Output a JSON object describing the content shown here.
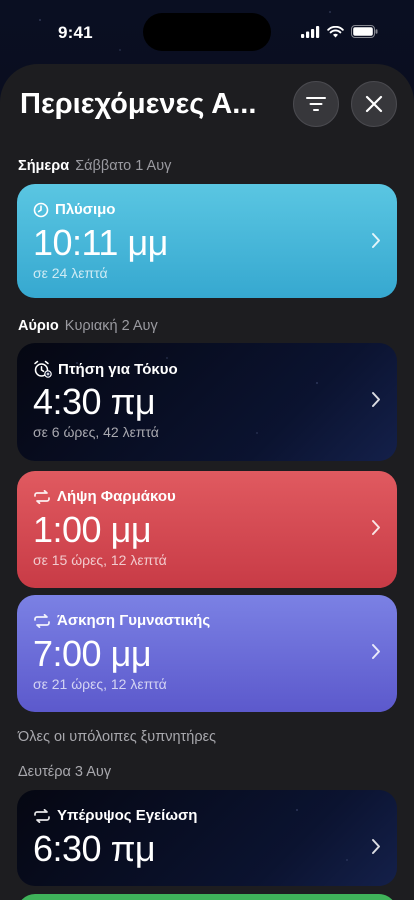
{
  "status_bar": {
    "time": "9:41"
  },
  "sheet": {
    "title": "Περιεχόμενες Α..."
  },
  "sections": {
    "today": {
      "day": "Σήμερα",
      "date": "Σάββατο 1 Αυγ"
    },
    "tomorrow": {
      "day": "Αύριο",
      "date": "Κυριακή 2 Αυγ"
    },
    "others": {
      "label": "Όλες οι υπόλοιπες ξυπνητήρες"
    },
    "monday": {
      "day": "Δευτέρα 3 Αυγ"
    }
  },
  "alarms": [
    {
      "label": "Πλύσιμο",
      "time": "10:11",
      "period": "μμ",
      "sub": "σε 24 λεπτά",
      "icon": "clock-icon",
      "color": "#48b8da"
    },
    {
      "label": "Πτήση για Τόκυο",
      "time": "4:30",
      "period": "πμ",
      "sub": "σε 6 ώρες, 42 λεπτά",
      "icon": "alarm-clock-icon",
      "color": "#0b1330"
    },
    {
      "label": "Λήψη Φαρμάκου",
      "time": "1:00",
      "period": "μμ",
      "sub": "σε 15 ώρες, 12 λεπτά",
      "icon": "repeat-icon",
      "color": "#d44b53"
    },
    {
      "label": "Άσκηση Γυμναστικής",
      "time": "7:00",
      "period": "μμ",
      "sub": "σε 21 ώρες, 12 λεπτά",
      "icon": "repeat-icon",
      "color": "#6b6dd8"
    },
    {
      "label": "Υπέρυψος Εγείωση",
      "time": "6:30",
      "period": "πμ",
      "icon": "repeat-icon",
      "color": "#0b1330"
    }
  ],
  "icons": {
    "filter": "filter-icon",
    "close": "close-icon",
    "chevron": "chevron-right-icon"
  }
}
